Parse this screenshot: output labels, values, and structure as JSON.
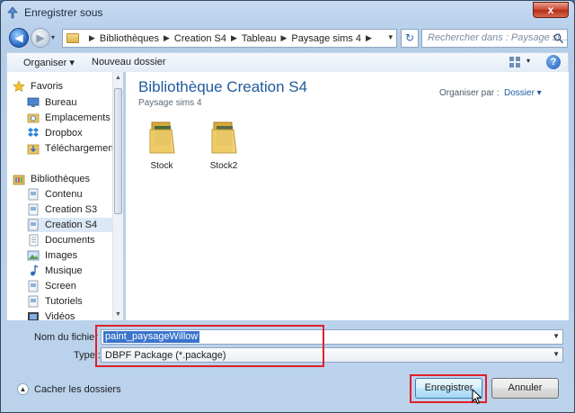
{
  "window": {
    "title": "Enregistrer sous",
    "close_glyph": "x"
  },
  "address": {
    "crumbs": [
      "Bibliothèques",
      "Creation S4",
      "Tableau",
      "Paysage sims 4"
    ],
    "search_placeholder": "Rechercher dans : Paysage si..."
  },
  "toolbar": {
    "organize_label": "Organiser ▾",
    "new_folder_label": "Nouveau dossier",
    "help_label": "?"
  },
  "sidebar": {
    "favorites_label": "Favoris",
    "favorites": [
      "Bureau",
      "Emplacements ré",
      "Dropbox",
      "Téléchargements"
    ],
    "libraries_label": "Bibliothèques",
    "libraries": [
      "Contenu",
      "Creation S3",
      "Creation S4",
      "Documents",
      "Images",
      "Musique",
      "Screen",
      "Tutoriels",
      "Vidéos"
    ],
    "selected": "Creation S4"
  },
  "main": {
    "library_title": "Bibliothèque Creation S4",
    "library_subtitle": "Paysage sims 4",
    "arrange_label": "Organiser par :",
    "arrange_value": "Dossier ▾",
    "folders": [
      "Stock",
      "Stock2"
    ]
  },
  "form": {
    "filename_label": "Nom du fichier :",
    "filename_value": "paint_paysageWillow",
    "type_label": "Type :",
    "type_value": "DBPF Package (*.package)"
  },
  "footer": {
    "hide_folders_label": "Cacher les dossiers",
    "save_label": "Enregistrer",
    "cancel_label": "Annuler"
  },
  "colors": {
    "highlight_box": "#e0202a",
    "selection": "#3b74cc",
    "library_title": "#1e5a9c"
  }
}
